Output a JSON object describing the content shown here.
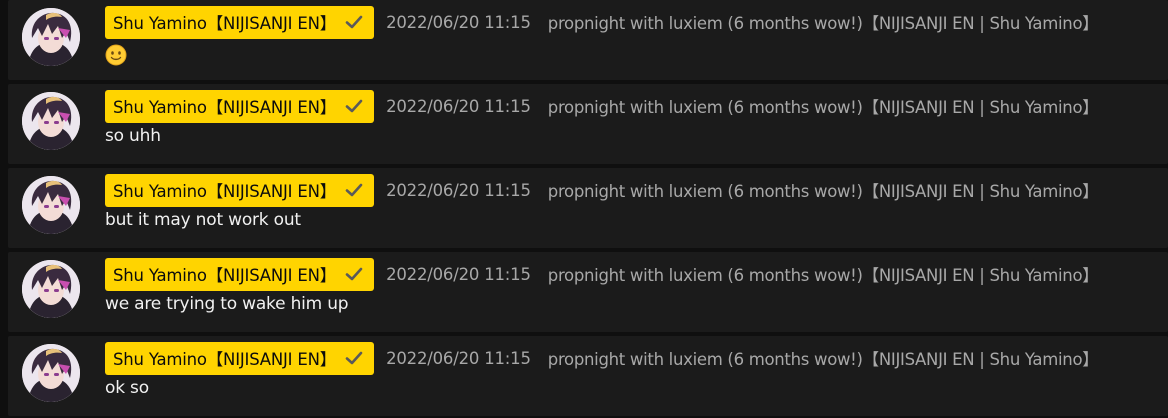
{
  "messages": [
    {
      "author": "Shu Yamino【NIJISANJI EN】",
      "verified_icon": "checkmark-icon",
      "timestamp": "2022/06/20 11:15",
      "stream_title": "propnight with luxiem (6 months wow!)【NIJISANJI EN | Shu Yamino】",
      "text": "",
      "emoji": "slightly-smiling-face"
    },
    {
      "author": "Shu Yamino【NIJISANJI EN】",
      "verified_icon": "checkmark-icon",
      "timestamp": "2022/06/20 11:15",
      "stream_title": "propnight with luxiem (6 months wow!)【NIJISANJI EN | Shu Yamino】",
      "text": "so uhh"
    },
    {
      "author": "Shu Yamino【NIJISANJI EN】",
      "verified_icon": "checkmark-icon",
      "timestamp": "2022/06/20 11:15",
      "stream_title": "propnight with luxiem (6 months wow!)【NIJISANJI EN | Shu Yamino】",
      "text": "but it may not work out"
    },
    {
      "author": "Shu Yamino【NIJISANJI EN】",
      "verified_icon": "checkmark-icon",
      "timestamp": "2022/06/20 11:15",
      "stream_title": "propnight with luxiem (6 months wow!)【NIJISANJI EN | Shu Yamino】",
      "text": "we are trying to wake him up"
    },
    {
      "author": "Shu Yamino【NIJISANJI EN】",
      "verified_icon": "checkmark-icon",
      "timestamp": "2022/06/20 11:15",
      "stream_title": "propnight with luxiem (6 months wow!)【NIJISANJI EN | Shu Yamino】",
      "text": "ok so"
    }
  ],
  "colors": {
    "page_background": "#0f0f0f",
    "row_background": "#1b1b1b",
    "author_badge": "#ffd400",
    "meta_text": "#a8a8a8",
    "message_text": "#f1f1f1"
  }
}
